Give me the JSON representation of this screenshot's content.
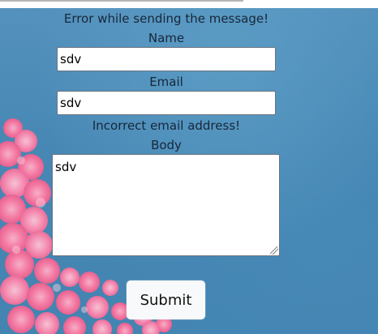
{
  "theme": {
    "background": "#4a8ab5",
    "blossom_color": "#ff7ea6",
    "button_background": "#f8f9fa",
    "text_color": "#17273a"
  },
  "form": {
    "error_message": "Error while sending the message!",
    "name_label": "Name",
    "name_value": "sdv",
    "email_label": "Email",
    "email_value": "sdv",
    "email_error": "Incorrect email address!",
    "body_label": "Body",
    "body_value": "sdv",
    "submit_label": "Submit"
  }
}
